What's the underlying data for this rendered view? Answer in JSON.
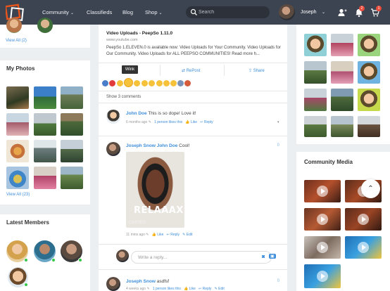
{
  "header": {
    "nav": [
      {
        "label": "Community",
        "has_dropdown": true
      },
      {
        "label": "Classifieds",
        "has_dropdown": false
      },
      {
        "label": "Blog",
        "has_dropdown": false
      },
      {
        "label": "Shop",
        "has_dropdown": true
      }
    ],
    "search_placeholder": "Search",
    "user_name": "Joseph",
    "notif_count": "2",
    "cart_count": "1",
    "colors": {
      "bar": "#3d4451",
      "accent": "#e8551a",
      "badge": "#e74c3c",
      "link": "#3d8edb",
      "online": "#36c84a"
    },
    "icons": [
      "logo-icon",
      "search-icon",
      "add-friend-icon",
      "bell-icon",
      "cart-icon",
      "chevron-down-icon"
    ]
  },
  "left": {
    "friends_view_all": "View All (2)",
    "photos_title": "My Photos",
    "photos_view_all": "View All (23)",
    "members_title": "Latest Members"
  },
  "feed": {
    "link_title": "Video Uploads - PeepSo 1.11.0",
    "link_url": "www.youtube.com",
    "link_desc": "PeepSo 1.ELEVEN.0 is available now: Video Uploads for Your Community. Video Uploads for Our Community. Video Uploads for ALL PEEPSO COMMUNITIES! Read more h...",
    "actions": {
      "repost": "RePost",
      "share": "Share"
    },
    "tooltip": "Wink",
    "show_comments": "Show 3 comments",
    "comments": [
      {
        "name": "John Doe",
        "text": "This is so dope! Love it!",
        "time": "6 months ago",
        "likes": "1 person likes this",
        "like": "Like",
        "reply": "Reply"
      },
      {
        "name": "Joseph Snow",
        "mention": "John Doe",
        "text": "Cool!",
        "time": "11 mins ago",
        "like": "Like",
        "reply": "Reply",
        "edit": "Edit",
        "video_label": "RELAAAX",
        "video_brand": "cameo"
      },
      {
        "name": "Joseph Snow",
        "text": "asdfsf",
        "time": "4 weeks ago",
        "like": "Like",
        "reply": "Reply",
        "edit": "Edit",
        "likes": "1 person likes this"
      }
    ],
    "reply_placeholder": "Write a reply..."
  },
  "right": {
    "media_title": "Community Media"
  }
}
